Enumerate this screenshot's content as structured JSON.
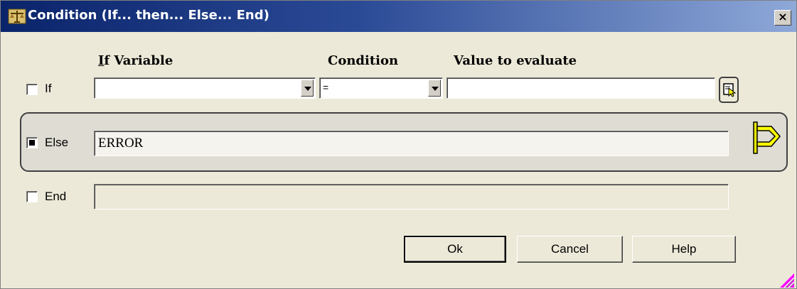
{
  "window": {
    "title": "Condition (If... then... Else... End)",
    "close_glyph": "×",
    "title_icon": "scales-icon"
  },
  "headers": {
    "if_variable_first": "I",
    "if_variable_rest": "f Variable",
    "condition": "Condition",
    "value_to_evaluate": "Value to evaluate"
  },
  "if_row": {
    "label": "If",
    "checked": false,
    "variable_value": "",
    "condition_value": "=",
    "evaluate_value": "",
    "pick_icon": "select-value-icon"
  },
  "else_row": {
    "label": "Else",
    "checked": true,
    "value": "ERROR",
    "marker_icon": "yellow-flag-arrow-icon"
  },
  "end_row": {
    "label": "End",
    "checked": false,
    "value": ""
  },
  "buttons": {
    "ok": "Ok",
    "cancel": "Cancel",
    "help": "Help"
  },
  "colors": {
    "title_gradient_start": "#0a246a",
    "title_gradient_end": "#8ea8d8",
    "dialog_bg": "#ece9d8",
    "else_marker": "#ffff00"
  }
}
